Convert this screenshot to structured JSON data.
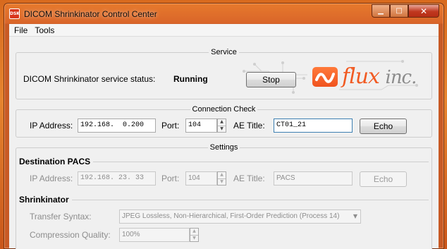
{
  "window": {
    "title": "DICOM Shrinkinator Control Center",
    "app_icon_text": "DSK"
  },
  "menu": {
    "items": [
      "File",
      "Tools"
    ]
  },
  "service": {
    "group_title": "Service",
    "status_label": "DICOM Shrinkinator service status:",
    "status_value": "Running",
    "stop_label": "Stop",
    "logo_word": "flux",
    "logo_suffix": "inc."
  },
  "connection_check": {
    "group_title": "Connection Check",
    "ip_label": "IP Address:",
    "ip_value": "192.168.  0.200",
    "port_label": "Port:",
    "port_value": "104",
    "ae_label": "AE Title:",
    "ae_value": "CT01_21",
    "echo_label": "Echo"
  },
  "settings": {
    "group_title": "Settings",
    "destination": {
      "heading": "Destination PACS",
      "ip_label": "IP Address:",
      "ip_value": "192.168. 23. 33",
      "port_label": "Port:",
      "port_value": "104",
      "ae_label": "AE Title:",
      "ae_value": "PACS",
      "echo_label": "Echo"
    },
    "shrinkinator": {
      "heading": "Shrinkinator",
      "transfer_syntax_label": "Transfer Syntax:",
      "transfer_syntax_value": "JPEG Lossless, Non-Hierarchical, First-Order Prediction (Process 14)",
      "compression_label": "Compression Quality:",
      "compression_value": "100%"
    }
  },
  "colors": {
    "accent": "#f15a22",
    "frame": "#d9652a"
  }
}
